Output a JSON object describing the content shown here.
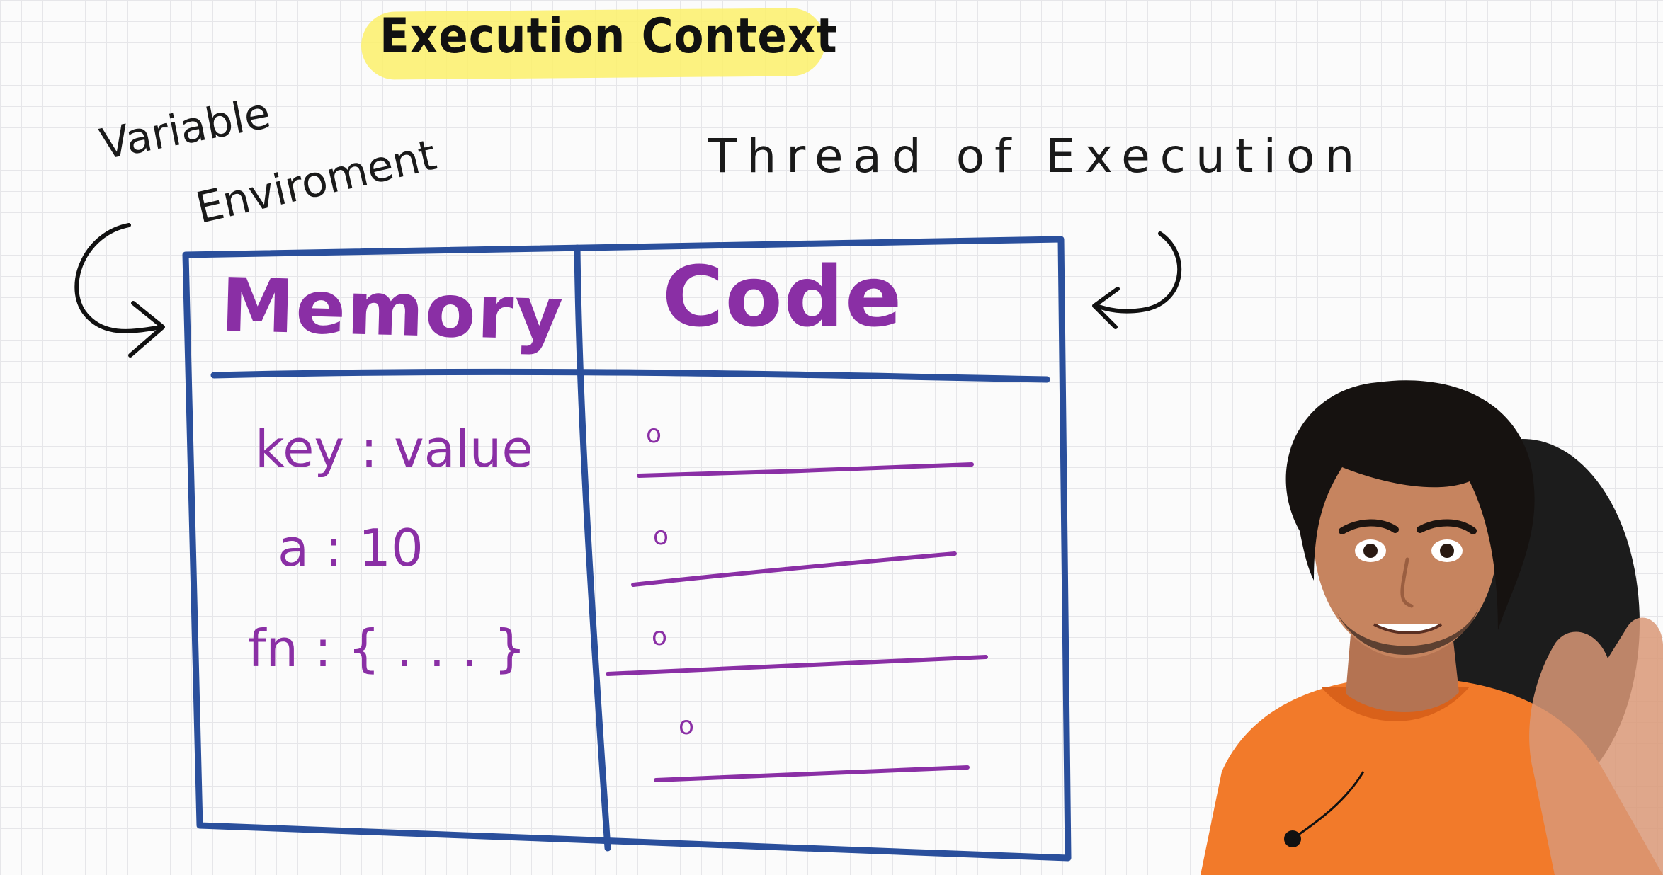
{
  "title": "Execution Context",
  "labels": {
    "variable": "Variable",
    "environment": "Enviroment",
    "thread": "Thread of Execution"
  },
  "table": {
    "left_header": "Memory",
    "right_header": "Code",
    "memory_rows": [
      "key : value",
      "a : 10",
      "fn : { . . . }"
    ],
    "code_steps": [
      "o",
      "o",
      "o",
      "o"
    ]
  },
  "colors": {
    "box_border": "#2a4f9c",
    "handwriting": "#8a2fa5",
    "highlight": "#fbf06a",
    "shirt": "#f27a2a"
  }
}
